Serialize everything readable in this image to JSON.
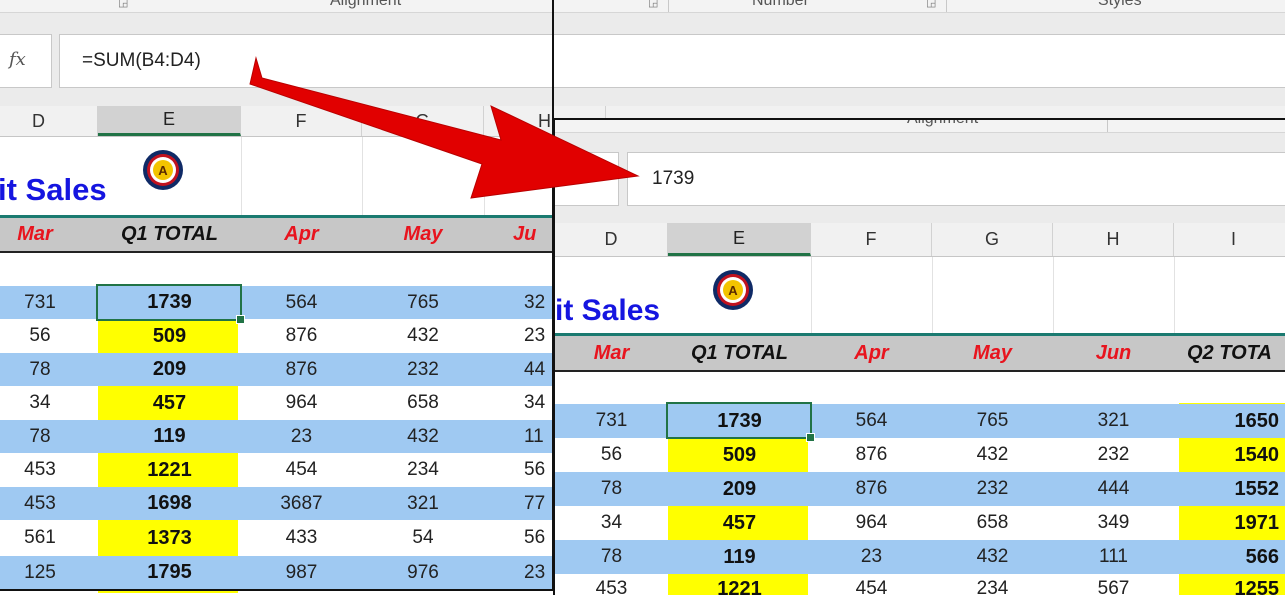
{
  "ribbon": {
    "group1": "Alignment",
    "group2": "Number",
    "group3": "Styles"
  },
  "back": {
    "formula": "=SUM(B4:D4)",
    "fx_label": "fx",
    "columns": [
      "D",
      "E",
      "F",
      "G",
      "H"
    ],
    "title": "it Sales",
    "headers": [
      "Mar",
      "Q1 TOTAL",
      "Apr",
      "May",
      "Ju"
    ],
    "rows": [
      [
        "731",
        "1739",
        "564",
        "765",
        "32"
      ],
      [
        "56",
        "509",
        "876",
        "432",
        "23"
      ],
      [
        "78",
        "209",
        "876",
        "232",
        "44"
      ],
      [
        "34",
        "457",
        "964",
        "658",
        "34"
      ],
      [
        "78",
        "119",
        "23",
        "432",
        "11"
      ],
      [
        "453",
        "1221",
        "454",
        "234",
        "56"
      ],
      [
        "453",
        "1698",
        "3687",
        "321",
        "77"
      ],
      [
        "561",
        "1373",
        "433",
        "54",
        "56"
      ],
      [
        "125",
        "1795",
        "987",
        "976",
        "23"
      ]
    ]
  },
  "front": {
    "formula": "1739",
    "fx_label": "fx",
    "ribbon_partial": "Alignment",
    "columns": [
      "D",
      "E",
      "F",
      "G",
      "H",
      "I"
    ],
    "title": "it Sales",
    "headers": [
      "Mar",
      "Q1 TOTAL",
      "Apr",
      "May",
      "Jun",
      "Q2 TOTA"
    ],
    "rows": [
      [
        "731",
        "1739",
        "564",
        "765",
        "321",
        "1650"
      ],
      [
        "56",
        "509",
        "876",
        "432",
        "232",
        "1540"
      ],
      [
        "78",
        "209",
        "876",
        "232",
        "444",
        "1552"
      ],
      [
        "34",
        "457",
        "964",
        "658",
        "349",
        "1971"
      ],
      [
        "78",
        "119",
        "23",
        "432",
        "111",
        "566"
      ],
      [
        "453",
        "1221",
        "454",
        "234",
        "567",
        "1255"
      ]
    ]
  },
  "colors": {
    "accent_green": "#217346",
    "highlight_yellow": "#ffff00",
    "row_blue": "#9fc9f2",
    "arrow_red": "#e10000",
    "month_red": "#e8141e",
    "title_blue": "#1515e0"
  },
  "icons": [
    "fx-icon",
    "logo-icon",
    "red-arrow-icon",
    "fill-handle-icon"
  ]
}
